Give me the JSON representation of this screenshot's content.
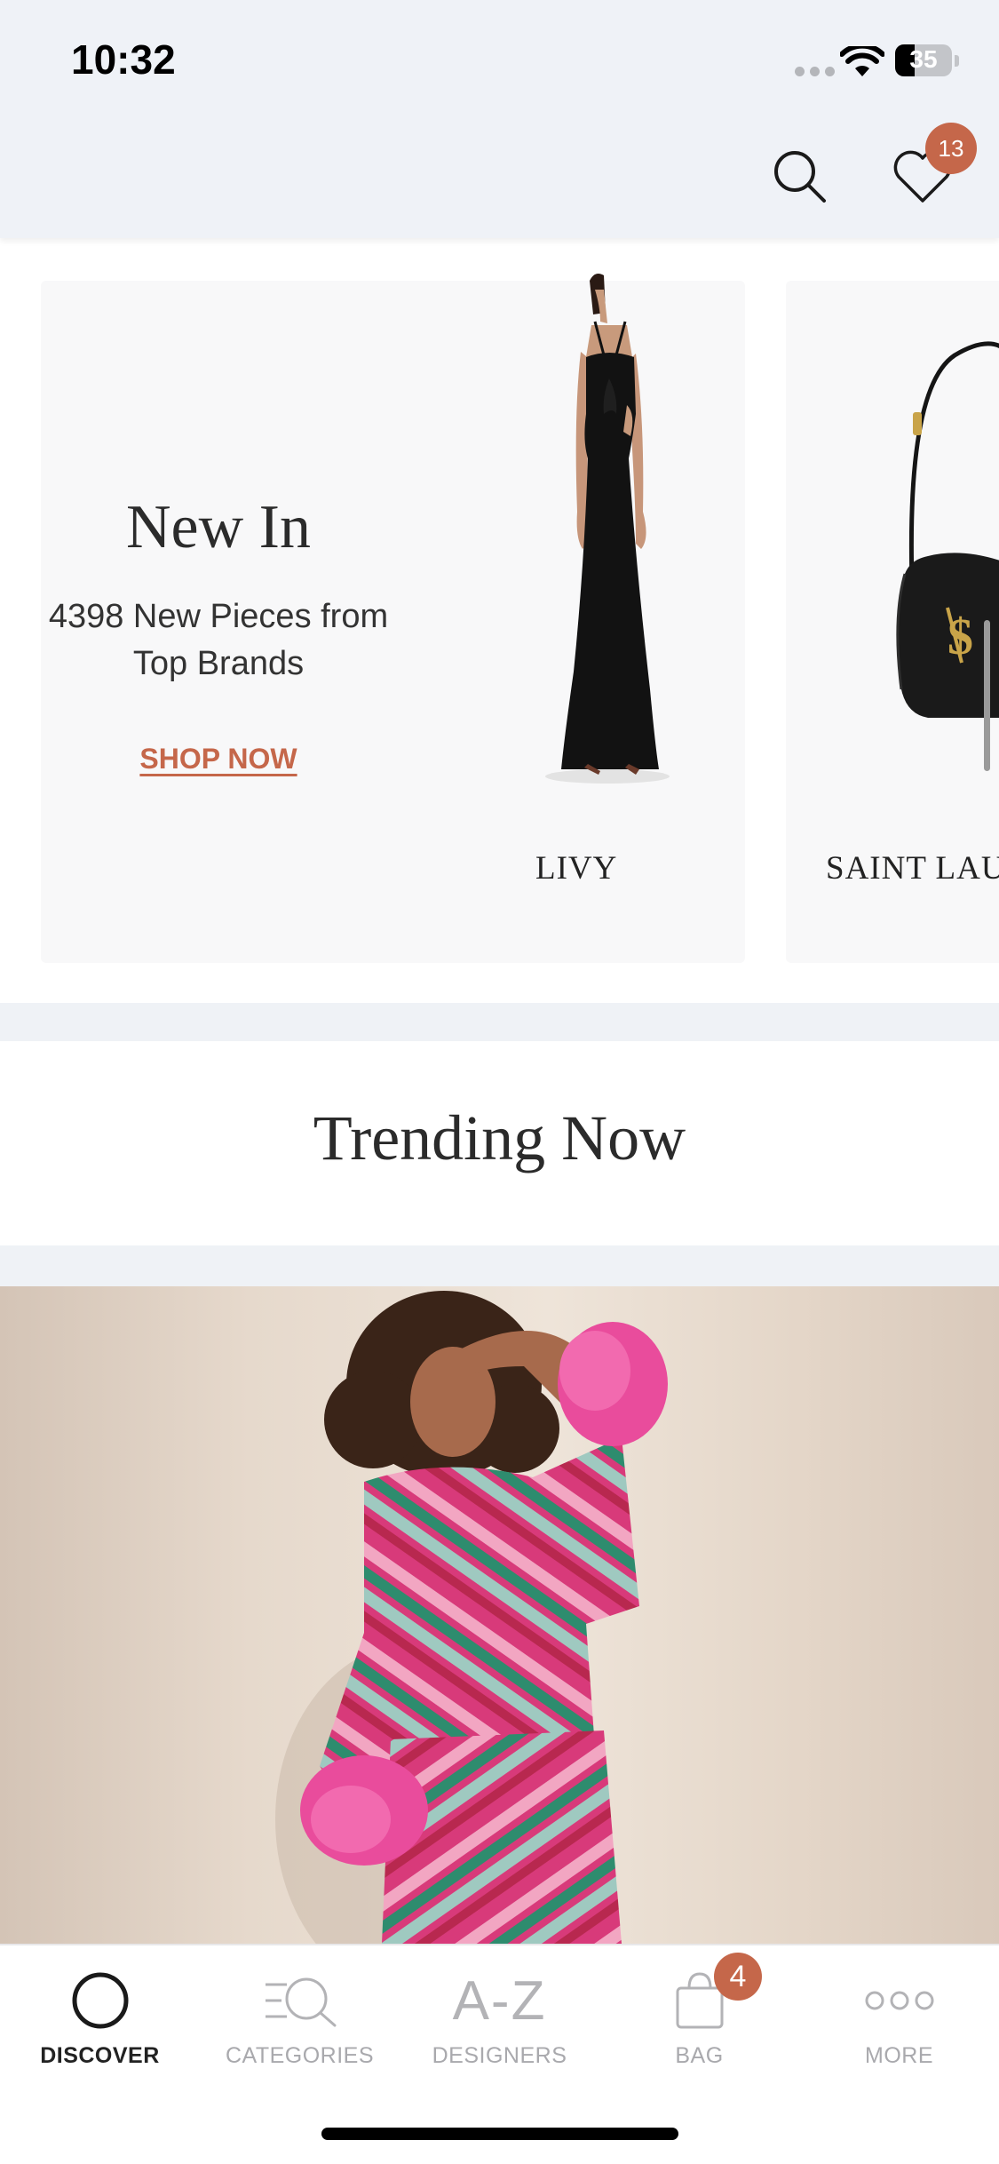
{
  "status_bar": {
    "time": "10:32",
    "battery": "35",
    "battery_level": 0.35
  },
  "header": {
    "wishlist_count": "13"
  },
  "new_in": {
    "title": "New In",
    "subtitle": "4398 New Pieces from Top Brands",
    "cta": "SHOP NOW"
  },
  "brands": [
    {
      "name": "LIVY"
    },
    {
      "name": "SAINT LAU"
    }
  ],
  "trending": {
    "title": "Trending Now"
  },
  "bottom_nav": {
    "items": [
      {
        "label": "DISCOVER",
        "icon": "discover-ring-icon",
        "active": true
      },
      {
        "label": "CATEGORIES",
        "icon": "categories-search-icon",
        "active": false
      },
      {
        "label": "DESIGNERS",
        "icon": "a-z-icon",
        "icon_text": "A-Z",
        "active": false
      },
      {
        "label": "BAG",
        "icon": "shopping-bag-icon",
        "active": false
      },
      {
        "label": "MORE",
        "icon": "more-dots-icon",
        "active": false
      }
    ],
    "bag_count": "4"
  },
  "colors": {
    "accent": "#c5674a",
    "header_bg": "#eff2f7",
    "active_text": "#222222",
    "inactive_text": "#a9a9ad"
  }
}
